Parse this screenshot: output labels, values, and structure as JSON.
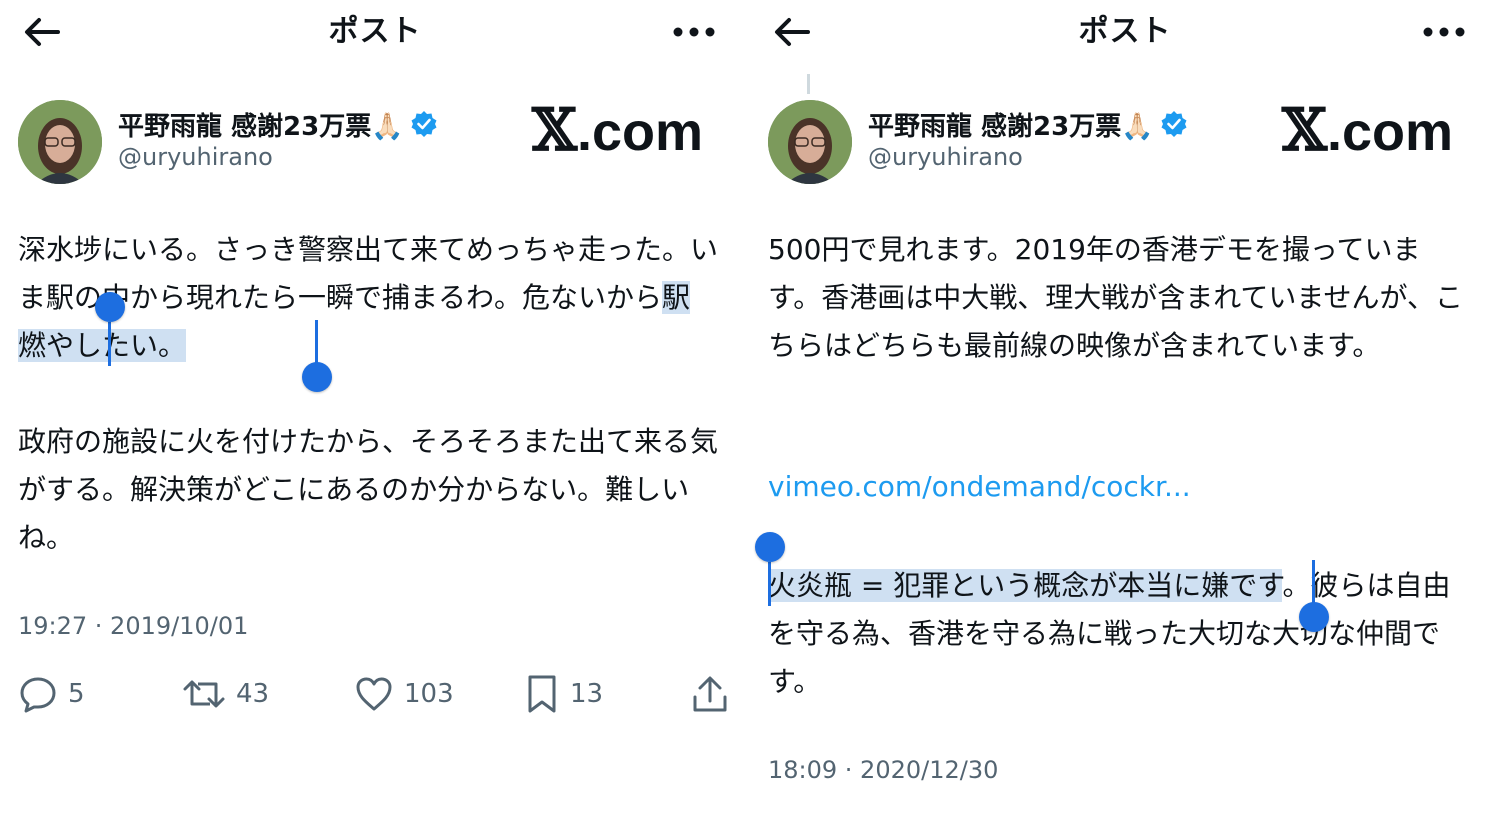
{
  "left": {
    "header": {
      "title": "ポスト",
      "back_icon": "arrow-left-icon",
      "more_icon": "more-dots-icon"
    },
    "author": {
      "display_name": "平野雨龍 感謝23万票🙏🏻",
      "handle": "@uryuhirano",
      "verified_icon": "verified-badge-icon",
      "verified_color": "#1d9bf0"
    },
    "watermark": {
      "x": "𝕏",
      "text": ".com"
    },
    "text": {
      "p1_pre": "深水埗にいる。さっき警察出て来てめっちゃ走った。いま駅の中から現れたら一瞬で捕まるわ。危ないから",
      "p1_sel": "駅燃やしたい。",
      "p2": "政府の施設に火を付けたから、そろそろまた出て来る気がする。解決策がどこにあるのか分からない。難しいね。"
    },
    "timestamp": "19:27 · 2019/10/01",
    "actions": {
      "reply": {
        "icon": "reply-icon",
        "count": "5"
      },
      "repost": {
        "icon": "repost-icon",
        "count": "43"
      },
      "like": {
        "icon": "heart-icon",
        "count": "103"
      },
      "bookmark": {
        "icon": "bookmark-icon",
        "count": "13"
      },
      "share": {
        "icon": "share-icon"
      }
    }
  },
  "right": {
    "header": {
      "title": "ポスト",
      "back_icon": "arrow-left-icon",
      "more_icon": "more-dots-icon"
    },
    "author": {
      "display_name": "平野雨龍 感謝23万票🙏🏻",
      "handle": "@uryuhirano",
      "verified_icon": "verified-badge-icon",
      "verified_color": "#1d9bf0"
    },
    "watermark": {
      "x": "𝕏",
      "text": ".com"
    },
    "text": {
      "p1": "500円で見れます。2019年の香港デモを撮っています。香港画は中大戦、理大戦が含まれていませんが、こちらはどちらも最前線の映像が含まれています。",
      "link": "vimeo.com/ondemand/cockr...",
      "p2_sel": "火炎瓶 = 犯罪という概念が本当に嫌です",
      "p2_post": "。彼らは自由を守る為、香港を守る為に戦った大切な大切な仲間です。"
    },
    "timestamp": "18:09 · 2020/12/30"
  },
  "colors": {
    "selection_bg": "#cfe0f2",
    "selection_handle": "#1d6ee0",
    "link": "#1d9bf0",
    "secondary_text": "#536471"
  }
}
